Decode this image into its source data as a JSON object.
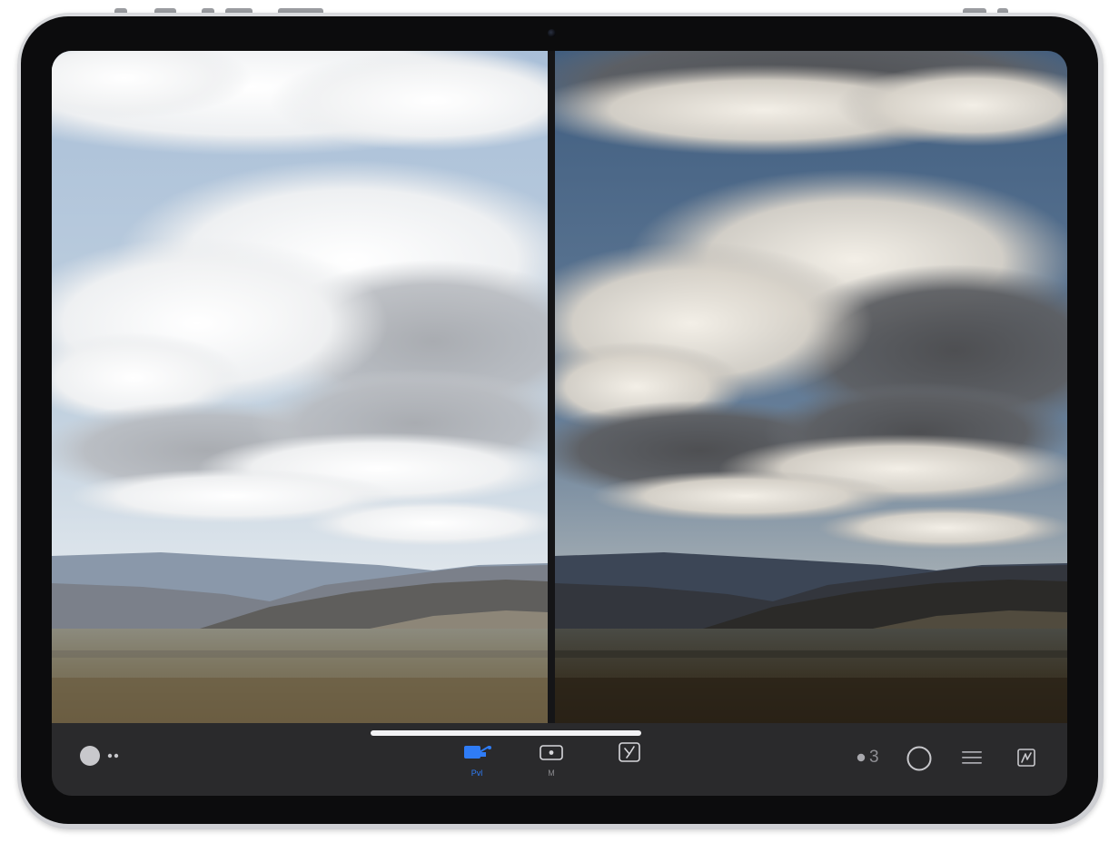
{
  "toolbar": {
    "tools": [
      {
        "name": "crop",
        "label": "Pvl",
        "active": true
      },
      {
        "name": "adjust",
        "label": "M",
        "active": false
      },
      {
        "name": "retouch",
        "label": "",
        "active": false
      }
    ],
    "page_count": "3"
  },
  "colors": {
    "accent": "#2f7cf6",
    "toolbar_bg": "#2a2a2c",
    "icon_gray": "#8e8e93",
    "bezel": "#0c0c0d"
  },
  "icons": {
    "left_toggle": "toggle-pill-icon",
    "crop": "crop-icon",
    "adjust": "adjust-icon",
    "retouch": "retouch-icon",
    "circle": "circle-icon",
    "menu": "hamburger-menu-icon",
    "export": "export-icon"
  }
}
